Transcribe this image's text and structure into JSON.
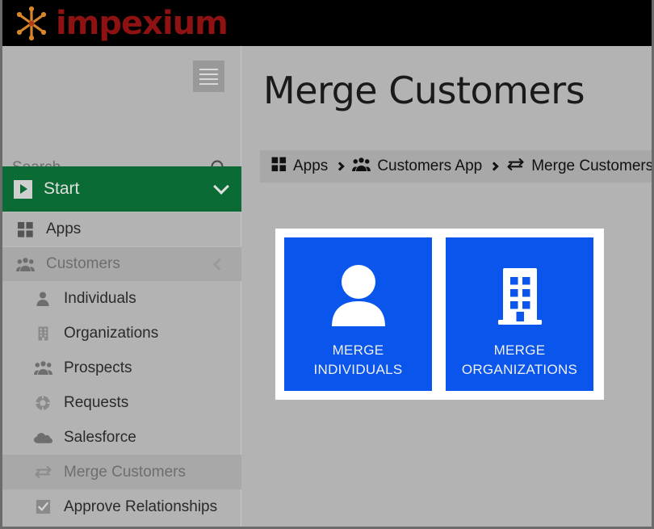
{
  "brand": {
    "name": "impexium",
    "logo_icon": "starburst-icon",
    "text_color": "#8e1212",
    "accent_color": "#d9862b",
    "bar_color": "#000000"
  },
  "sidebar": {
    "hamburger_icon": "hamburger-menu-icon",
    "search": {
      "placeholder": "Search...",
      "value": "",
      "icon": "search-icon"
    },
    "start": {
      "label": "Start",
      "icon": "play-square-icon",
      "chevron": "chevron-down-icon",
      "color": "#0a6b34"
    },
    "items": [
      {
        "label": "Apps",
        "icon": "grid-apps-icon",
        "level": "top",
        "state": "normal"
      },
      {
        "label": "Customers",
        "icon": "people-group-icon",
        "level": "top",
        "state": "active",
        "chevron": "chevron-left-icon"
      },
      {
        "label": "Individuals",
        "icon": "person-icon",
        "level": "sub",
        "state": "normal"
      },
      {
        "label": "Organizations",
        "icon": "building-icon",
        "level": "sub",
        "state": "normal"
      },
      {
        "label": "Prospects",
        "icon": "people-group-icon",
        "level": "sub",
        "state": "normal"
      },
      {
        "label": "Requests",
        "icon": "life-ring-icon",
        "level": "sub",
        "state": "normal"
      },
      {
        "label": "Salesforce",
        "icon": "cloud-icon",
        "level": "sub",
        "state": "normal"
      },
      {
        "label": "Merge Customers",
        "icon": "merge-arrows-icon",
        "level": "sub",
        "state": "active"
      },
      {
        "label": "Approve Relationships",
        "icon": "checkbox-checked-icon",
        "level": "sub",
        "state": "normal"
      }
    ]
  },
  "main": {
    "title": "Merge Customers",
    "breadcrumb": [
      {
        "label": "Apps",
        "icon": "grid-apps-icon"
      },
      {
        "label": "Customers App",
        "icon": "people-group-icon"
      },
      {
        "label": "Merge Customers",
        "icon": "merge-arrows-icon"
      }
    ],
    "tiles": [
      {
        "label_line1": "MERGE",
        "label_line2": "INDIVIDUALS",
        "icon": "person-icon",
        "color": "#0a55ec"
      },
      {
        "label_line1": "MERGE",
        "label_line2": "ORGANIZATIONS",
        "icon": "building-icon",
        "color": "#0a55ec"
      }
    ]
  }
}
